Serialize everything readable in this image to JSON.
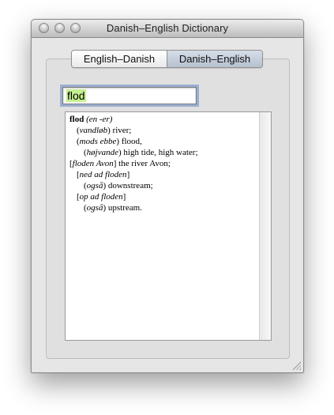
{
  "window": {
    "title": "Danish–English Dictionary"
  },
  "tabs": [
    {
      "label": "English–Danish",
      "selected": false
    },
    {
      "label": "Danish–English",
      "selected": true
    }
  ],
  "search": {
    "value": "flod"
  },
  "entry": {
    "headword": "flod",
    "gram": "(en -er)",
    "lines": [
      {
        "indent": 1,
        "segs": [
          "(",
          "vandløb",
          ") river;"
        ]
      },
      {
        "indent": 1,
        "segs": [
          "(",
          "mods ebbe",
          ") flood,"
        ]
      },
      {
        "indent": 2,
        "segs": [
          "(",
          "højvande",
          ") high tide, high water;"
        ]
      },
      {
        "indent": 0,
        "segs": [
          "[",
          "floden Avon",
          "] the river Avon;"
        ]
      },
      {
        "indent": 1,
        "segs": [
          "[",
          "ned ad floden",
          "]"
        ]
      },
      {
        "indent": 2,
        "segs": [
          "(",
          "også",
          ") downstream;"
        ]
      },
      {
        "indent": 1,
        "segs": [
          "[",
          "op ad floden",
          "]"
        ]
      },
      {
        "indent": 2,
        "segs": [
          "(",
          "også",
          ") upstream."
        ]
      }
    ]
  },
  "colors": {
    "search_highlight": "#c6f092",
    "focus_ring": "#9aaed0"
  }
}
